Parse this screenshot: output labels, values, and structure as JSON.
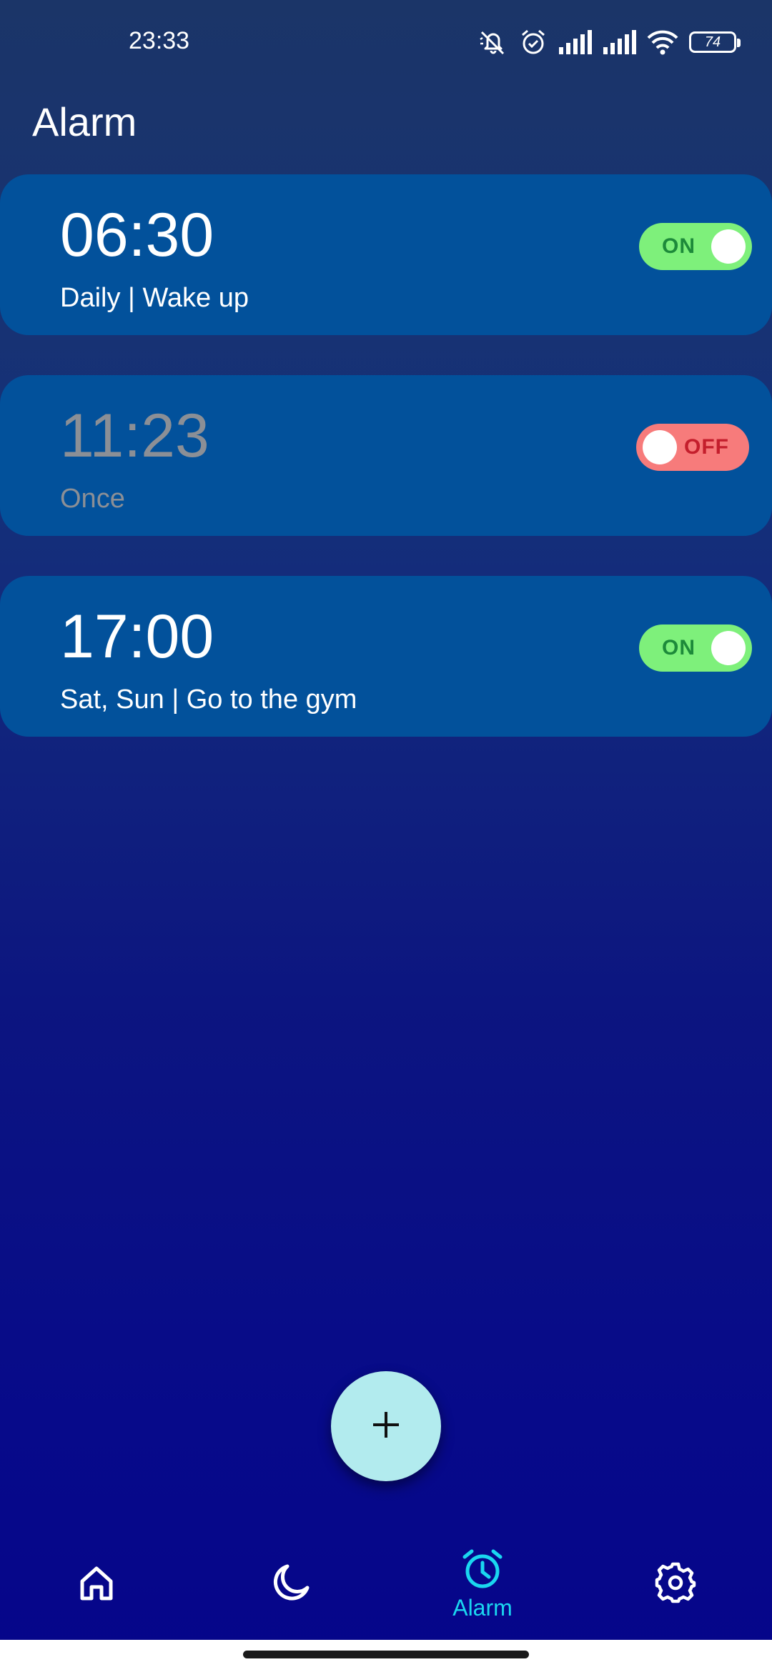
{
  "status_bar": {
    "time": "23:33",
    "battery": "74",
    "icons": [
      "mute-icon",
      "alarm-icon",
      "signal-icon",
      "signal-icon",
      "wifi-icon",
      "battery-icon"
    ]
  },
  "page": {
    "title": "Alarm"
  },
  "alarms": [
    {
      "time": "06:30",
      "subtitle": "Daily | Wake up",
      "toggle_label": "ON",
      "enabled": true
    },
    {
      "time": "11:23",
      "subtitle": "Once",
      "toggle_label": "OFF",
      "enabled": false
    },
    {
      "time": "17:00",
      "subtitle": "Sat, Sun | Go to the gym",
      "toggle_label": "ON",
      "enabled": true
    }
  ],
  "fab": {
    "icon": "plus-icon"
  },
  "bottom_nav": {
    "items": [
      {
        "icon": "home-icon",
        "label": ""
      },
      {
        "icon": "moon-icon",
        "label": ""
      },
      {
        "icon": "alarm-clock-icon",
        "label": "Alarm",
        "active": true
      },
      {
        "icon": "gear-icon",
        "label": ""
      }
    ]
  },
  "colors": {
    "card": "#02519b",
    "toggle_on": "#7ef07b",
    "toggle_off": "#f77b7b",
    "fab": "#b2ebee",
    "nav_active": "#1ad7f0"
  }
}
